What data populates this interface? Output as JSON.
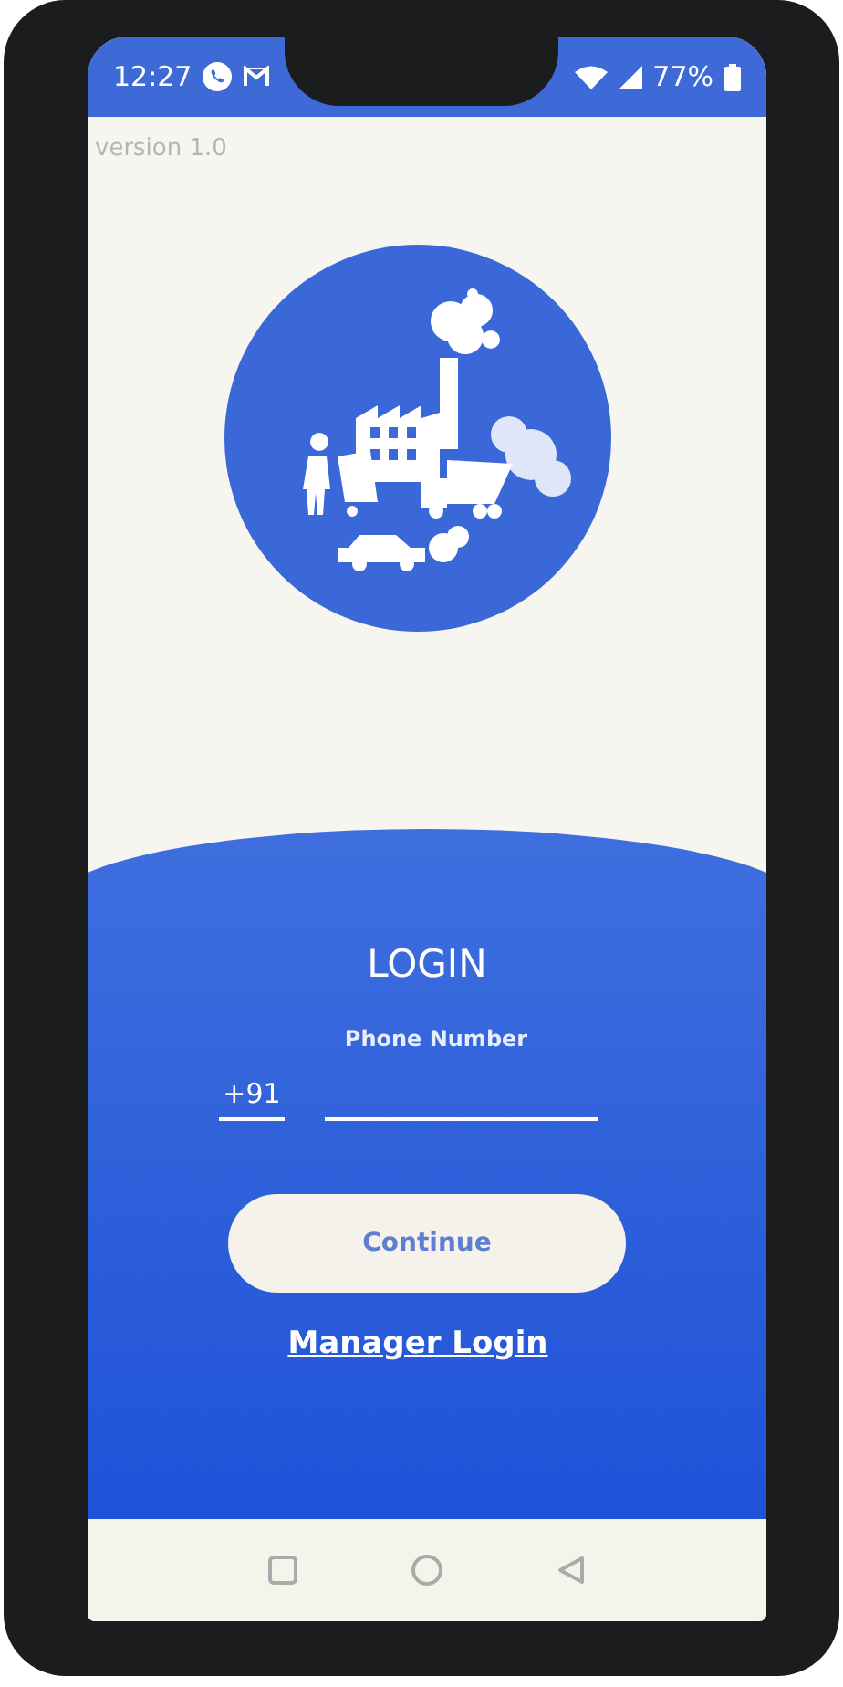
{
  "status_bar": {
    "time": "12:27",
    "battery": "77%"
  },
  "version": "version 1.0",
  "login": {
    "title": "LOGIN",
    "phone_field": {
      "label": "Phone Number",
      "country_code": "+91"
    },
    "continue_button": "Continue",
    "manager_link": "Manager Login"
  }
}
